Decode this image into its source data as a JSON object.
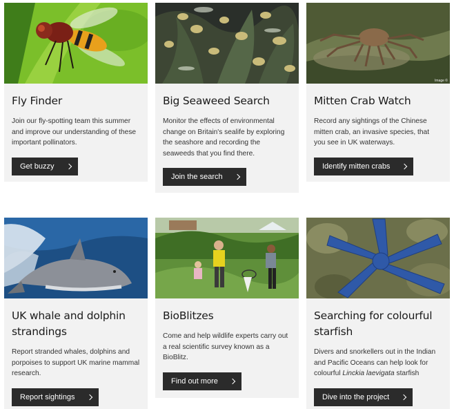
{
  "cards": [
    {
      "title": "Fly Finder",
      "text": "Join our fly-spotting team this summer and improve our understanding of these important pollinators.",
      "button": "Get buzzy",
      "image_icon": "hoverfly-photo"
    },
    {
      "title": "Big Seaweed Search",
      "text": "Monitor the effects of environmental change on Britain's sealife by exploring the seashore and recording the seaweeds that you find there.",
      "button": "Join the search",
      "image_icon": "seaweed-photo"
    },
    {
      "title": "Mitten Crab Watch",
      "text": "Record any sightings of the Chinese mitten crab, an invasive species, that you see in UK waterways.",
      "button": "Identify mitten crabs",
      "image_icon": "crab-photo",
      "image_credit": "Image ©"
    },
    {
      "title": "UK whale and dolphin strandings",
      "text": "Report stranded whales, dolphins and porpoises to support UK marine mammal research.",
      "button": "Report sightings",
      "image_icon": "dolphin-photo"
    },
    {
      "title": "BioBlitzes",
      "text": "Come and help wildlife experts carry out a real scientific survey known as a BioBlitz.",
      "button": "Find out more",
      "image_icon": "bioblitz-photo"
    },
    {
      "title": "Searching for colourful starfish",
      "text_before": "Divers and snorkellers out in the Indian and Pacific Oceans can help look for colourful ",
      "text_em": "Linckia laevigata",
      "text_after": " starfish",
      "button": "Dive into the project",
      "image_icon": "starfish-photo"
    }
  ]
}
